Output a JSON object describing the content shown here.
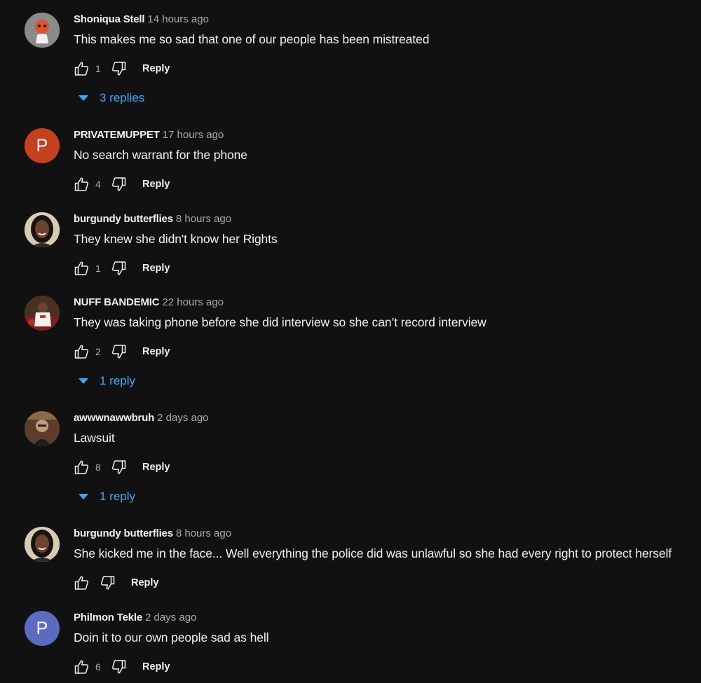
{
  "comments": [
    {
      "author": "Shoniqua Stell",
      "time": "14 hours ago",
      "text": "This makes me so sad that one of our people has been mistreated",
      "likes": "1",
      "reply_label": "Reply",
      "replies_label": "3 replies",
      "avatar": {
        "kind": "image",
        "bg": "#7a7a7a"
      }
    },
    {
      "author": "PRIVATEMUPPET",
      "time": "17 hours ago",
      "text": "No search warrant for the phone",
      "likes": "4",
      "reply_label": "Reply",
      "avatar": {
        "kind": "letter",
        "letter": "P",
        "bg": "#c4401f"
      }
    },
    {
      "author": "burgundy butterflies",
      "time": "8 hours ago",
      "text": "They knew she didn't know her Rights",
      "likes": "1",
      "reply_label": "Reply",
      "avatar": {
        "kind": "image",
        "bg": "#d9cbb3"
      }
    },
    {
      "author": "NUFF BANDEMIC",
      "time": "22 hours ago",
      "text": "They was taking phone before she did interview so she can’t record interview",
      "likes": "2",
      "reply_label": "Reply",
      "replies_label": "1 reply",
      "avatar": {
        "kind": "image",
        "bg": "#5a3b2e"
      }
    },
    {
      "author": "awwwnawwbruh",
      "time": "2 days ago",
      "text": "Lawsuit",
      "likes": "8",
      "reply_label": "Reply",
      "replies_label": "1 reply",
      "avatar": {
        "kind": "image",
        "bg": "#6b4a36"
      }
    },
    {
      "author": "burgundy butterflies",
      "time": "8 hours ago",
      "text": "She kicked me in the face... Well everything the police did was unlawful so she had every right to protect herself",
      "likes": "",
      "reply_label": "Reply",
      "avatar": {
        "kind": "image",
        "bg": "#d9cbb3"
      }
    },
    {
      "author": "Philmon Tekle",
      "time": "2 days ago",
      "text": "Doin it to our own people sad as hell",
      "likes": "6",
      "reply_label": "Reply",
      "avatar": {
        "kind": "letter",
        "letter": "P",
        "bg": "#5c6bc0"
      }
    }
  ],
  "colors": {
    "background": "#111111",
    "accent": "#3ea6ff",
    "secondary_text": "#aaaaaa"
  },
  "icons": {
    "like": "thumbs-up-icon",
    "dislike": "thumbs-down-icon",
    "expand": "caret-down-icon"
  }
}
